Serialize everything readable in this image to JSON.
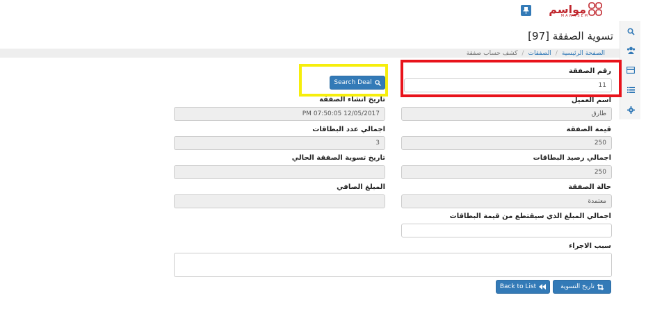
{
  "brand": {
    "name": "مواسم",
    "tagline": "MAWASEM",
    "color": "#c0262d"
  },
  "header": {
    "page_title": "تسوية الصفقة [97]"
  },
  "breadcrumb": {
    "home": "الصفحة الرئيسية",
    "deals": "الصفقات",
    "current": "كشف حساب صفقة"
  },
  "sidebar": {
    "items": [
      "search-icon",
      "users-icon",
      "card-icon",
      "list-icon",
      "gear-icon"
    ]
  },
  "form": {
    "deal_number": {
      "label": "رقم الصفقة",
      "value": "11"
    },
    "search_button": "Search Deal",
    "customer_name": {
      "label": "أسم العميل",
      "value": "طارق"
    },
    "created_date": {
      "label": "تاريخ انشاء الصفقة",
      "value": "12/05/2017 07:50:05 PM"
    },
    "deal_value": {
      "label": "قيمة الصفقة",
      "value": "250"
    },
    "cards_count": {
      "label": "اجمالي عدد البطاقات",
      "value": "3"
    },
    "cards_balance": {
      "label": "اجمالي رصيد البطاقات",
      "value": "250"
    },
    "settlement_date": {
      "label": "تاريخ تسوية الصفقة الحالي",
      "value": ""
    },
    "deal_status": {
      "label": "حالة الصفقة",
      "value": "معتمدة"
    },
    "net_amount": {
      "label": "المبلغ الصافي",
      "value": ""
    },
    "deduct_total": {
      "label": "اجمالي المبلغ الذي سيقتطع من قيمة البطاقات",
      "value": ""
    },
    "reason": {
      "label": "سبب الاجراء",
      "value": ""
    }
  },
  "actions": {
    "back_to_list": "Back to List",
    "settle": "تاريخ التسوية"
  },
  "colors": {
    "primary": "#337ab7",
    "highlight_red": "#e8131b",
    "highlight_yellow": "#f6ee0c"
  }
}
